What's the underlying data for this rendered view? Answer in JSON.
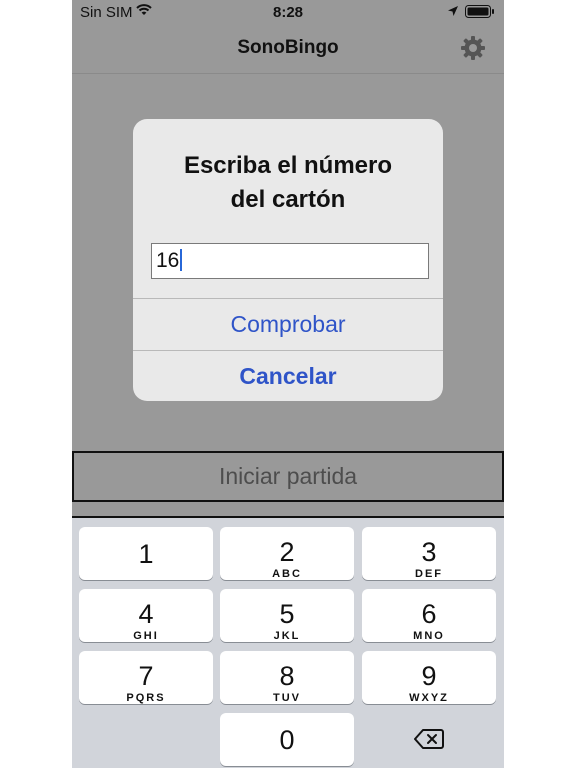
{
  "status_bar": {
    "carrier": "Sin SIM",
    "time": "8:28"
  },
  "navbar": {
    "title": "SonoBingo",
    "settings_icon": "gear-icon"
  },
  "main": {
    "start_button": "Iniciar partida"
  },
  "alert": {
    "title_line1": "Escriba el número",
    "title_line2": "del cartón",
    "input_value": "16",
    "confirm": "Comprobar",
    "cancel": "Cancelar"
  },
  "keyboard": {
    "keys": [
      {
        "num": "1",
        "letters": ""
      },
      {
        "num": "2",
        "letters": "ABC"
      },
      {
        "num": "3",
        "letters": "DEF"
      },
      {
        "num": "4",
        "letters": "GHI"
      },
      {
        "num": "5",
        "letters": "JKL"
      },
      {
        "num": "6",
        "letters": "MNO"
      },
      {
        "num": "7",
        "letters": "PQRS"
      },
      {
        "num": "8",
        "letters": "TUV"
      },
      {
        "num": "9",
        "letters": "WXYZ"
      },
      {
        "num": "0",
        "letters": ""
      }
    ],
    "delete_icon": "backspace-icon"
  },
  "colors": {
    "accent": "#2f54c8",
    "dim_background": "#999999",
    "keyboard_bg": "#d1d4da"
  }
}
